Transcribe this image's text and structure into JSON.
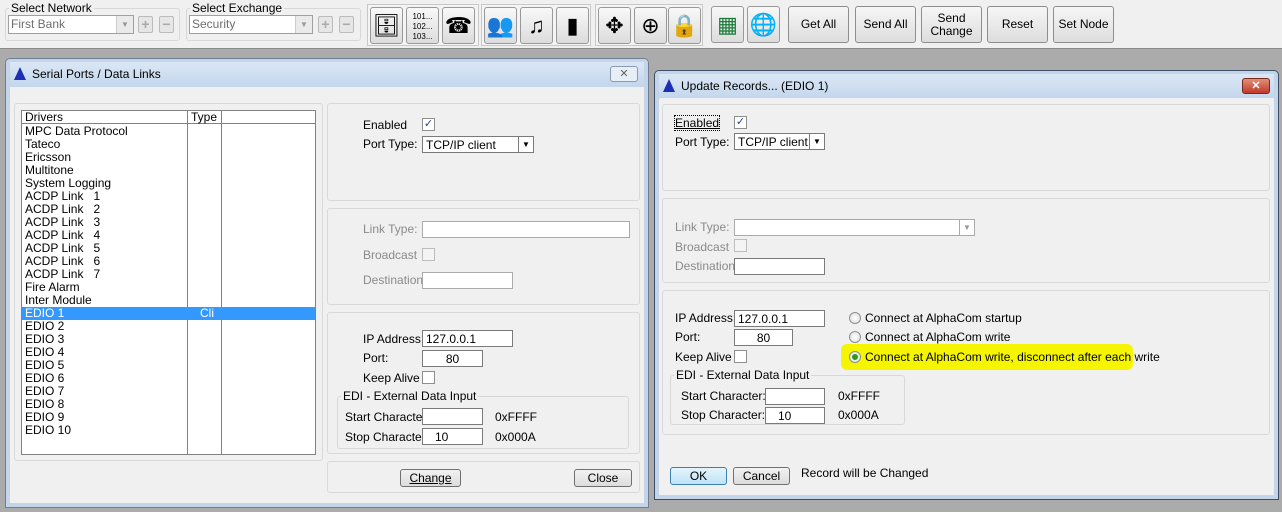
{
  "toolbar": {
    "network_label": "Select Network",
    "network_value": "First Bank",
    "exchange_label": "Select Exchange",
    "exchange_value": "Security",
    "buttons": [
      "Get All",
      "Send All",
      "Send\nChange",
      "Reset",
      "Set Node"
    ],
    "icon_button_numbers": "101...\n102...\n103..."
  },
  "left_window": {
    "title": "Serial Ports / Data Links",
    "close": "✕",
    "list": {
      "headers": [
        "Drivers",
        "Type"
      ],
      "rows": [
        [
          "MPC Data Protocol",
          ""
        ],
        [
          "Tateco",
          ""
        ],
        [
          "Ericsson",
          ""
        ],
        [
          "Multitone",
          ""
        ],
        [
          "System Logging",
          ""
        ],
        [
          "ACDP Link   1",
          ""
        ],
        [
          "ACDP Link   2",
          ""
        ],
        [
          "ACDP Link   3",
          ""
        ],
        [
          "ACDP Link   4",
          ""
        ],
        [
          "ACDP Link   5",
          ""
        ],
        [
          "ACDP Link   6",
          ""
        ],
        [
          "ACDP Link   7",
          ""
        ],
        [
          "Fire Alarm",
          ""
        ],
        [
          "Inter Module",
          ""
        ],
        [
          "EDIO 1",
          "Cli"
        ],
        [
          "EDIO 2",
          ""
        ],
        [
          "EDIO 3",
          ""
        ],
        [
          "EDIO 4",
          ""
        ],
        [
          "EDIO 5",
          ""
        ],
        [
          "EDIO 6",
          ""
        ],
        [
          "EDIO 7",
          ""
        ],
        [
          "EDIO 8",
          ""
        ],
        [
          "EDIO 9",
          ""
        ],
        [
          "EDIO 10",
          ""
        ]
      ],
      "selected_index": 14
    },
    "enabled_label": "Enabled",
    "port_type_label": "Port Type:",
    "port_type_value": "TCP/IP client",
    "link_type_label": "Link Type:",
    "broadcast_label": "Broadcast",
    "destination_label": "Destination:",
    "ip_label": "IP Address:",
    "ip_value": "127.0.0.1",
    "port_label": "Port:",
    "port_value": "80",
    "keep_alive_label": "Keep Alive",
    "edi_group": "EDI - External Data Input",
    "start_label": "Start Character:",
    "start_value": "",
    "start_hex": "0xFFFF",
    "stop_label": "Stop Character:",
    "stop_value": "10",
    "stop_hex": "0x000A",
    "change_button": "Change",
    "close_button": "Close"
  },
  "right_window": {
    "title": "Update Records...  (EDIO 1)",
    "close": "✕",
    "enabled_label": "Enabled",
    "port_type_label": "Port Type:",
    "port_type_value": "TCP/IP client",
    "link_type_label": "Link Type:",
    "broadcast_label": "Broadcast",
    "destination_label": "Destination:",
    "ip_label": "IP Address:",
    "ip_value": "127.0.0.1",
    "port_label": "Port:",
    "port_value": "80",
    "keep_alive_label": "Keep Alive",
    "radio_options": [
      "Connect at AlphaCom startup",
      "Connect at AlphaCom write",
      "Connect at AlphaCom write, disconnect after each write"
    ],
    "radio_selected": 2,
    "edi_group": "EDI - External Data Input",
    "start_label": "Start Character:",
    "start_value": "",
    "start_hex": "0xFFFF",
    "stop_label": "Stop Character:",
    "stop_value": "10",
    "stop_hex": "0x000A",
    "ok_button": "OK",
    "cancel_button": "Cancel",
    "status": "Record will be Changed",
    "highlight_color": "#f5f500"
  }
}
